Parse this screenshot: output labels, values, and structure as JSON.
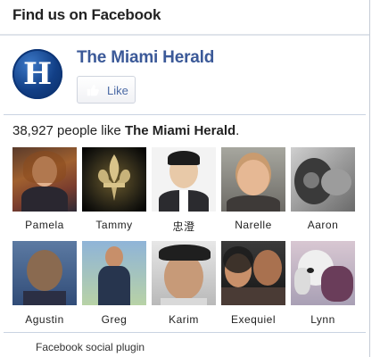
{
  "header": {
    "title": "Find us on Facebook"
  },
  "page": {
    "name": "The Miami Herald",
    "logo_letter": "H",
    "like_label": "Like"
  },
  "likes": {
    "count": "38,927",
    "text": " people like ",
    "page_name": "The Miami Herald",
    "end": "."
  },
  "faces": [
    {
      "name": "Pamela"
    },
    {
      "name": "Tammy"
    },
    {
      "name": "忠澄"
    },
    {
      "name": "Narelle"
    },
    {
      "name": "Aaron"
    },
    {
      "name": "Agustin"
    },
    {
      "name": "Greg"
    },
    {
      "name": "Karim"
    },
    {
      "name": "Exequiel"
    },
    {
      "name": "Lynn"
    }
  ],
  "footer": {
    "text": "Facebook social plugin"
  },
  "colors": {
    "brand": "#3b5998",
    "divider": "#c9d3e2"
  }
}
